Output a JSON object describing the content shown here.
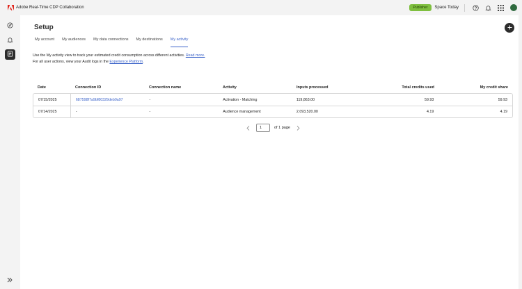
{
  "app": {
    "title": "Adobe Real-Time CDP Collaboration"
  },
  "header": {
    "badge": "Publisher",
    "org": "Space Today"
  },
  "page": {
    "title": "Setup"
  },
  "tabs": [
    {
      "label": "My account"
    },
    {
      "label": "My audiences"
    },
    {
      "label": "My data connections"
    },
    {
      "label": "My destinations"
    },
    {
      "label": "My activity"
    }
  ],
  "description": {
    "line1": "Use the My activity view to track your estimated credit consumption across different activities.",
    "line1_link": "Read more.",
    "line2_prefix": "For all user actions, view your Audit logs in the",
    "line2_link": "Experience Platform",
    "line2_suffix": "."
  },
  "table": {
    "headers": [
      "Date",
      "Connection ID",
      "Connection name",
      "Activity",
      "Inputs processed",
      "Total credits used",
      "My credit share"
    ],
    "rows": [
      [
        "07/15/2025",
        "687598f7a9bf80329deb0a97",
        "-",
        "Activation - Matching",
        "119,863.00",
        "59.93",
        "59.93"
      ],
      [
        "07/14/2025",
        "-",
        "-",
        "Audience management",
        "2,093,520.00",
        "4.19",
        "4.19"
      ]
    ]
  },
  "pagination": {
    "current": "1",
    "of_text": "of 1 page"
  },
  "colors": {
    "accent": "#3b63c9",
    "badge": "#7fbf3f",
    "rail_active": "#2c2c2c"
  }
}
